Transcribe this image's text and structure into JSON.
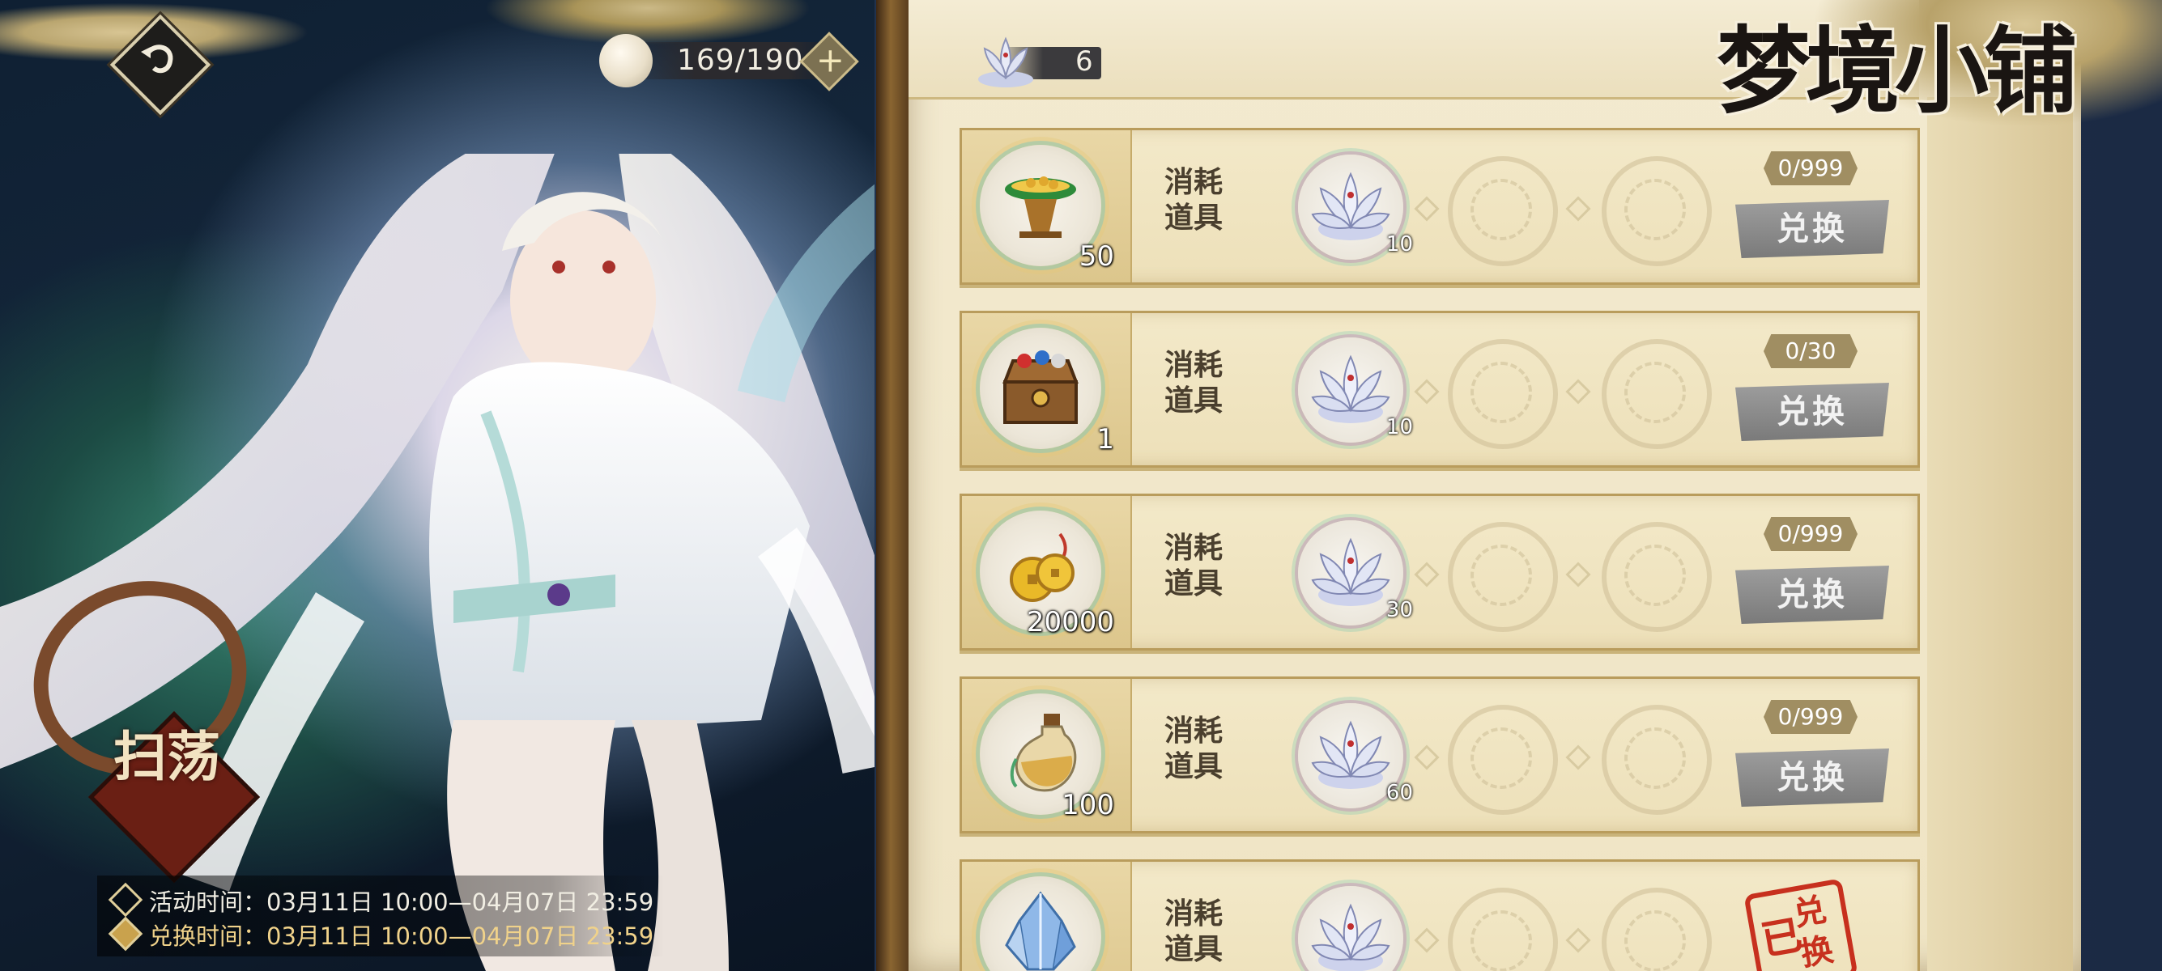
{
  "topbar": {
    "stamina": "169/190",
    "plus": "+"
  },
  "art": {
    "sweep_label": "扫荡",
    "activity_time": "活动时间：03月11日 10:00—04月07日 23:59",
    "exchange_time": "兑换时间：03月11日 10:00—04月07日 23:59"
  },
  "shop": {
    "title": "梦境小铺",
    "currency_count": "6",
    "items": [
      {
        "icon": "green-bowl-of-coins-icon",
        "qty": "50",
        "category": "消耗\n道具",
        "cost": "10",
        "limit": "0/999",
        "button": "兑换",
        "sold_out": false
      },
      {
        "icon": "treasure-chest-icon",
        "qty": "1",
        "category": "消耗\n道具",
        "cost": "10",
        "limit": "0/30",
        "button": "兑换",
        "sold_out": false
      },
      {
        "icon": "gold-coins-icon",
        "qty": "20000",
        "category": "消耗\n道具",
        "cost": "30",
        "limit": "0/999",
        "button": "兑换",
        "sold_out": false
      },
      {
        "icon": "potion-bottle-icon",
        "qty": "100",
        "category": "消耗\n道具",
        "cost": "60",
        "limit": "0/999",
        "button": "兑换",
        "sold_out": false
      },
      {
        "icon": "blue-crystal-icon",
        "qty": "",
        "category": "消耗\n道具",
        "cost": "",
        "limit": "",
        "button": "",
        "sold_out": true,
        "stamp_a": "已",
        "stamp_b": "兑换"
      }
    ]
  },
  "colors": {
    "accent": "#c7301e",
    "parchment": "#efe4c4",
    "button_gray": "#8c8c8c"
  }
}
